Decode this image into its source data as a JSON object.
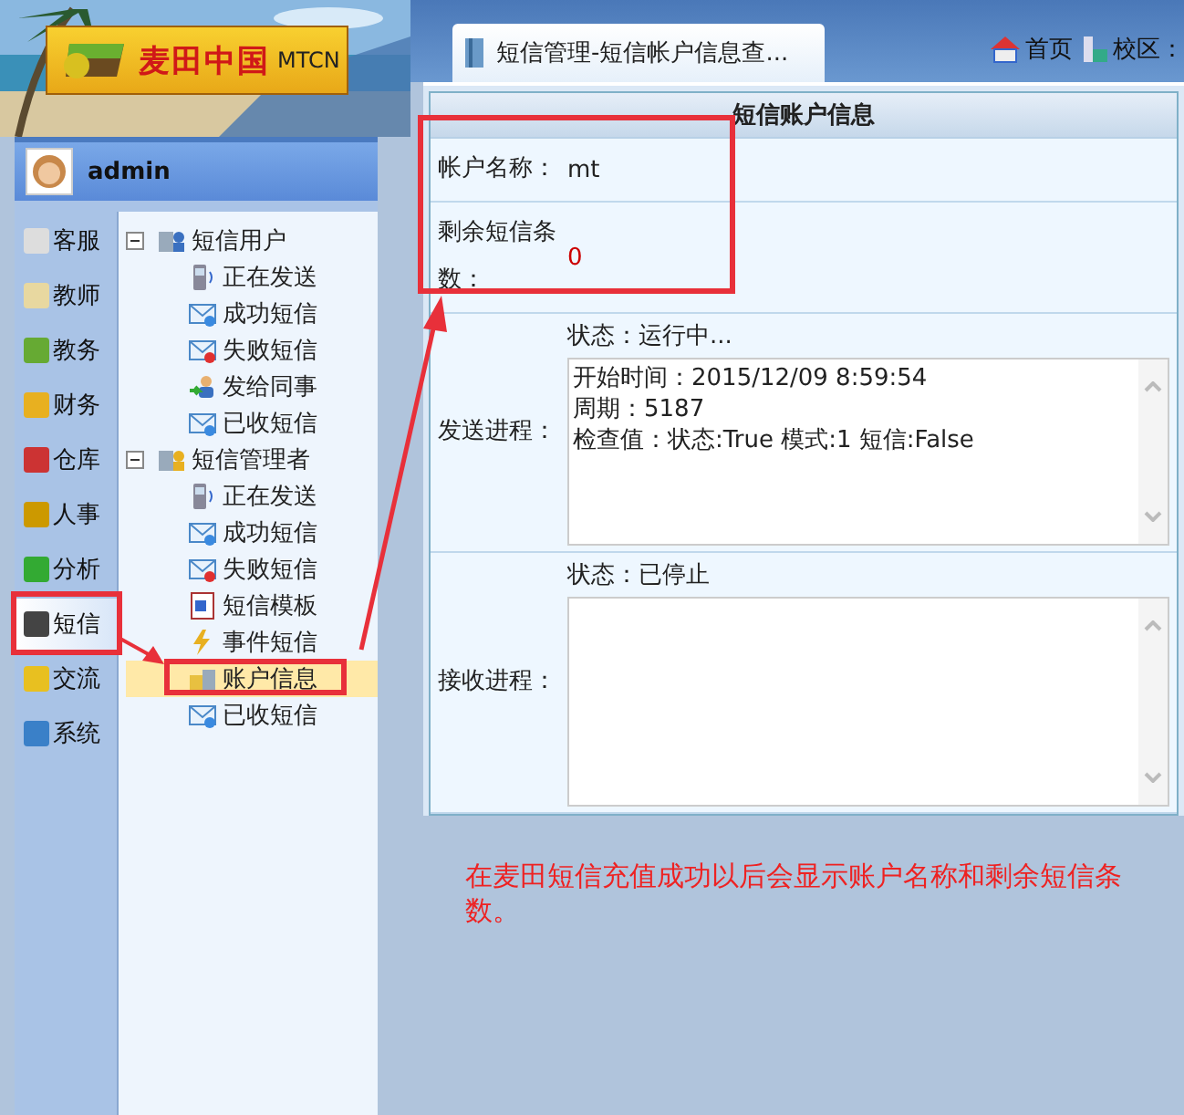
{
  "header": {
    "logo_text": "麦田中国",
    "logo_latin": "MTCN",
    "tab": {
      "label": "短信管理-短信帐户信息查...",
      "selected": true
    },
    "links": [
      "首页",
      "校区："
    ]
  },
  "user": {
    "name": "admin"
  },
  "nav": [
    {
      "label": "客服",
      "selected": false
    },
    {
      "label": "教师",
      "selected": false
    },
    {
      "label": "教务",
      "selected": false
    },
    {
      "label": "财务",
      "selected": false
    },
    {
      "label": "仓库",
      "selected": false
    },
    {
      "label": "人事",
      "selected": false
    },
    {
      "label": "分析",
      "selected": false
    },
    {
      "label": "短信",
      "selected": true
    },
    {
      "label": "交流",
      "selected": false
    },
    {
      "label": "系统",
      "selected": false
    }
  ],
  "tree": [
    {
      "label": "短信用户",
      "expanded": true,
      "children": [
        {
          "label": "正在发送",
          "selected": false
        },
        {
          "label": "成功短信",
          "selected": false
        },
        {
          "label": "失败短信",
          "selected": false
        },
        {
          "label": "发给同事",
          "selected": false
        },
        {
          "label": "已收短信",
          "selected": false
        }
      ]
    },
    {
      "label": "短信管理者",
      "expanded": true,
      "children": [
        {
          "label": "正在发送",
          "selected": false
        },
        {
          "label": "成功短信",
          "selected": false
        },
        {
          "label": "失败短信",
          "selected": false
        },
        {
          "label": "短信模板",
          "selected": false
        },
        {
          "label": "事件短信",
          "selected": false
        },
        {
          "label": "账户信息",
          "selected": true
        },
        {
          "label": "已收短信",
          "selected": false
        }
      ]
    }
  ],
  "panel": {
    "title": "短信账户信息",
    "account": [
      {
        "label": "帐户名称：",
        "value": "mt",
        "kind": "plain"
      },
      {
        "label": "剩余短信条数：",
        "value": "0",
        "kind": "alert"
      }
    ],
    "processes": [
      {
        "label": "发送进程：",
        "status": "状态：运行中...",
        "log": "开始时间：2015/12/09 8:59:54\n周期：5187\n检查值：状态:True 模式:1 短信:False"
      },
      {
        "label": "接收进程：",
        "status": "状态：已停止"
      }
    ]
  },
  "note": "在麦田短信充值成功以后会显示账户名称和剩余短信条数。"
}
